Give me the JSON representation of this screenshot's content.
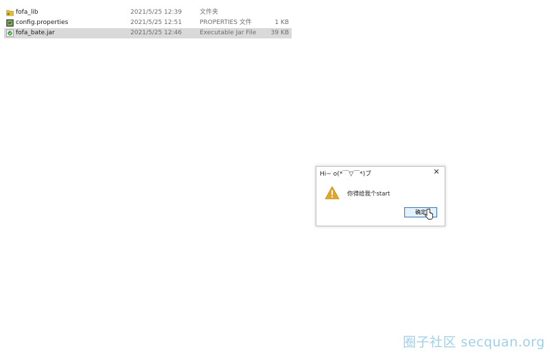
{
  "files": [
    {
      "name": "fofa_lib",
      "date": "2021/5/25 12:39",
      "type": "文件夹",
      "size": "",
      "icon": "folder-icon",
      "selected": false
    },
    {
      "name": "config.properties",
      "date": "2021/5/25 12:51",
      "type": "PROPERTIES 文件",
      "size": "1 KB",
      "icon": "properties-file-icon",
      "selected": false
    },
    {
      "name": "fofa_bate.jar",
      "date": "2021/5/25 12:46",
      "type": "Executable Jar File",
      "size": "39 KB",
      "icon": "jar-file-icon",
      "selected": true
    }
  ],
  "dialog": {
    "title": "Hi~ o(*￣▽￣*)ブ",
    "close_label": "✕",
    "message": "你得给我个start",
    "ok_label": "确定",
    "icon": "warning-icon"
  },
  "watermark": "圈子社区 secquan.org",
  "colors": {
    "selection": "#d9d9d9",
    "warning": "#e0a52b",
    "button_border": "#3c7fc4",
    "watermark": "#9fd0ea"
  }
}
